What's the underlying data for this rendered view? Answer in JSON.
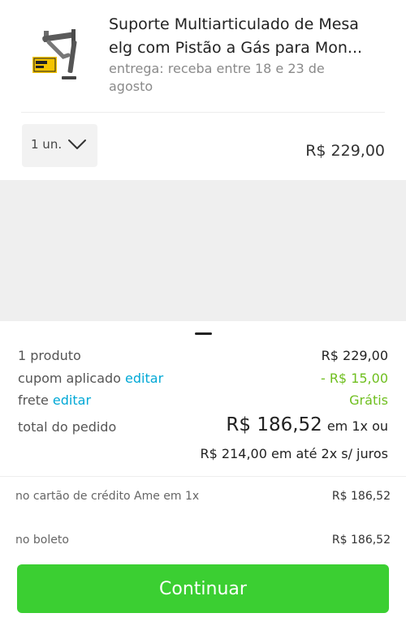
{
  "product": {
    "image_icon": "monitor-arm-product-image",
    "title": "Suporte Multiarticulado de Mesa elg com Pistão a Gás para Mon...",
    "delivery": "entrega: receba entre 18 e 23 de agosto",
    "quantity": "1 un.",
    "price": "R$ 229,00"
  },
  "summary": {
    "products_label": "1 produto",
    "products_value": "R$ 229,00",
    "coupon_label": "cupom aplicado",
    "coupon_edit": "editar",
    "coupon_value": "- R$ 15,00",
    "shipping_label": "frete",
    "shipping_edit": "editar",
    "shipping_value": "Grátis",
    "total_label": "total do pedido",
    "total_value": "R$ 186,52",
    "total_suffix": "em 1x ou",
    "installments": "R$ 214,00 em até 2x s/ juros"
  },
  "payment_options": [
    {
      "label": "no cartão de crédito Ame em 1x",
      "value": "R$ 186,52"
    },
    {
      "label": "no boleto",
      "value": "R$ 186,52"
    }
  ],
  "continue_label": "Continuar",
  "colors": {
    "accent_link": "#00a8d6",
    "discount_green": "#6fbf1f",
    "button_green": "#3bcf32"
  }
}
